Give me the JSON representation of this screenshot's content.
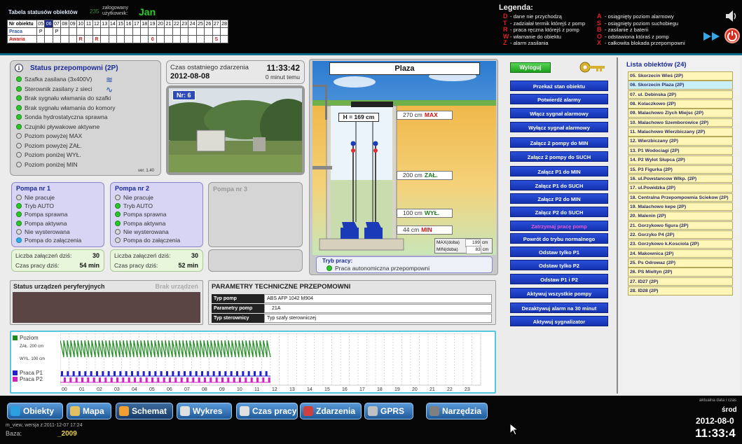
{
  "header": {
    "table_title": "Tabela statusów obiektów",
    "logged_count": "235",
    "user_label": "zalogowany użytkownik:",
    "user_name": "Jan",
    "grid_rows": [
      {
        "label": "Nr obiektu",
        "cells": [
          "05",
          "06",
          "07",
          "08",
          "09",
          "10",
          "11",
          "12",
          "13",
          "14",
          "15",
          "16",
          "17",
          "18",
          "19",
          "20",
          "21",
          "22",
          "23",
          "24",
          "25",
          "26",
          "27",
          "28"
        ]
      },
      {
        "label": "Praca",
        "cells": [
          "P",
          "",
          "P",
          "",
          "",
          "",
          "",
          "",
          "",
          "",
          "",
          "",
          "",
          "",
          "",
          "",
          "",
          "",
          "",
          "",
          "",
          "",
          "",
          ""
        ]
      },
      {
        "label": "Awaria",
        "cells": [
          "",
          "",
          "",
          "",
          "",
          "R",
          "",
          "R",
          "",
          "",
          "",
          "",
          "",
          "",
          "0",
          "",
          "",
          "",
          "",
          "",
          "",
          "",
          "S",
          ""
        ]
      }
    ]
  },
  "legend": {
    "title": "Legenda:",
    "left": [
      {
        "key": "D",
        "text": "- dane nie przychodzą"
      },
      {
        "key": "T",
        "text": "- zadziałał termik którejś z pomp"
      },
      {
        "key": "R",
        "text": "- praca ręczna którejś z pomp"
      },
      {
        "key": "W",
        "text": "- włamanie do obiektu"
      },
      {
        "key": "Z",
        "text": "- alarm zasilania"
      }
    ],
    "right": [
      {
        "key": "A",
        "text": "- osiągnięty poziom alarmowy"
      },
      {
        "key": "S",
        "text": "- osiągnięty poziom suchobiegu"
      },
      {
        "key": "B",
        "text": "- zasilanie z baterii"
      },
      {
        "key": "O",
        "text": "- odstawiona któraś z pomp"
      },
      {
        "key": "X",
        "text": "- całkowita blokada przepompowni"
      }
    ]
  },
  "status": {
    "title": "Status przepompowni (2P)",
    "version": "ver. 1.40",
    "items": [
      {
        "text": "Szafka zasilana (3x400V)",
        "state": "green"
      },
      {
        "text": "Sterownik zasilany z sieci",
        "state": "green"
      },
      {
        "text": "Brak sygnału włamania do szafki",
        "state": "green"
      },
      {
        "text": "Brak sygnału włamania do komory",
        "state": "green"
      },
      {
        "text": "Sonda hydrostatyczna sprawna",
        "state": "green"
      },
      {
        "text": "Czujniki pływakowe aktywne",
        "state": "green"
      },
      {
        "text": "Poziom powyżej MAX",
        "state": "off"
      },
      {
        "text": "Poziom powyżej ZAŁ.",
        "state": "off"
      },
      {
        "text": "Poziom poniżej WYŁ.",
        "state": "off"
      },
      {
        "text": "Poziom poniżej MIN",
        "state": "off"
      }
    ]
  },
  "last_event": {
    "label": "Czas ostatniego zdarzenia",
    "time": "11:33:42",
    "date": "2012-08-08",
    "ago": "0 minut temu"
  },
  "camera": {
    "label": "Nr: 6"
  },
  "pumps": [
    {
      "title": "Pompa nr 1",
      "items": [
        {
          "text": "Nie pracuje",
          "state": "off"
        },
        {
          "text": "Tryb AUTO",
          "state": "green"
        },
        {
          "text": "Pompa sprawna",
          "state": "green"
        },
        {
          "text": "Pompa aktywna",
          "state": "green"
        },
        {
          "text": "Nie wysterowana",
          "state": "off"
        },
        {
          "text": "Pompa do załączenia",
          "state": "blue"
        }
      ],
      "starts_label": "Liczba załączeń dziś:",
      "starts": "30",
      "time_label": "Czas pracy dziś:",
      "time": "54 min"
    },
    {
      "title": "Pompa nr 2",
      "items": [
        {
          "text": "Nie pracuje",
          "state": "off"
        },
        {
          "text": "Tryb AUTO",
          "state": "green"
        },
        {
          "text": "Pompa sprawna",
          "state": "green"
        },
        {
          "text": "Pompa aktywna",
          "state": "green"
        },
        {
          "text": "Nie wysterowana",
          "state": "off"
        },
        {
          "text": "Pompa do załączenia",
          "state": "off"
        }
      ],
      "starts_label": "Liczba załączeń dziś:",
      "starts": "30",
      "time_label": "Czas pracy dziś:",
      "time": "52 min"
    }
  ],
  "pump3": {
    "title": "Pompa nr 3"
  },
  "station": {
    "name": "Plaza",
    "height": "H = 169 cm",
    "levels": [
      {
        "label": "270 cm",
        "tag": "MAX",
        "color": "#d01010"
      },
      {
        "label": "200 cm",
        "tag": "ZAŁ.",
        "color": "#1a7a1a"
      },
      {
        "label": "100 cm",
        "tag": "WYŁ.",
        "color": "#1a7a1a"
      },
      {
        "label": "44 cm",
        "tag": "MIN",
        "color": "#d01010"
      }
    ],
    "max_label": "MAX(doba)",
    "max_value": "199",
    "max_unit": "cm",
    "min_label": "MIN(doba)",
    "min_value": "83",
    "min_unit": "cm",
    "mode_label": "Tryb pracy:",
    "mode": "Praca autonomiczna przepompowni"
  },
  "peripherals": {
    "title": "Status urządzeń peryferyjnych",
    "status": "Brak urządzeń"
  },
  "params": {
    "title": "PARAMETRY TECHNICZNE PRZEPOMOWNI",
    "rows": [
      {
        "label": "Typ pomp",
        "value": "ABS AFP 1042 M904"
      },
      {
        "label": "Parametry pomp",
        "value": "21A"
      },
      {
        "label": "Typ sterownicy",
        "value": "Typ szafy sterowniczej"
      }
    ]
  },
  "chart": {
    "legend": [
      {
        "name": "Poziom",
        "color": "#1a8a1a"
      },
      {
        "name": "ZAŁ. 200 cm",
        "color": ""
      },
      {
        "name": "WYŁ. 100 cm",
        "color": ""
      },
      {
        "name": "Praca P1",
        "color": "#2222cc"
      },
      {
        "name": "Praca P2",
        "color": "#d020c0"
      }
    ],
    "hours": [
      "00",
      "01",
      "02",
      "03",
      "04",
      "05",
      "06",
      "07",
      "08",
      "09",
      "10",
      "11",
      "12",
      "13",
      "14",
      "15",
      "16",
      "17",
      "18",
      "19",
      "20",
      "21",
      "22",
      "23"
    ]
  },
  "chart_data": {
    "type": "line",
    "x": [
      "00",
      "01",
      "02",
      "03",
      "04",
      "05",
      "06",
      "07",
      "08",
      "09",
      "10",
      "11",
      "12",
      "13",
      "14",
      "15",
      "16",
      "17",
      "18",
      "19",
      "20",
      "21",
      "22",
      "23"
    ],
    "series": [
      {
        "name": "Poziom",
        "values": [
          150,
          150,
          150,
          150,
          150,
          150,
          150,
          150,
          150,
          150,
          150,
          150,
          null,
          null,
          null,
          null,
          null,
          null,
          null,
          null,
          null,
          null,
          null,
          null
        ]
      },
      {
        "name": "Praca P1",
        "values": [
          1,
          1,
          1,
          1,
          1,
          1,
          1,
          1,
          1,
          1,
          1,
          1,
          null,
          null,
          null,
          null,
          null,
          null,
          null,
          null,
          null,
          null,
          null,
          null
        ]
      },
      {
        "name": "Praca P2",
        "values": [
          1,
          1,
          1,
          1,
          1,
          1,
          1,
          1,
          1,
          1,
          1,
          1,
          null,
          null,
          null,
          null,
          null,
          null,
          null,
          null,
          null,
          null,
          null,
          null
        ]
      }
    ],
    "levels": {
      "zal": 200,
      "wyl": 100
    }
  },
  "actions": {
    "logout": "Wyloguj",
    "buttons": [
      {
        "label": "Przekaż stan obiektu",
        "style": "blue"
      },
      {
        "label": "Potwierdź alarmy",
        "style": "blue"
      },
      {
        "label": "Włącz sygnał alarmowy",
        "style": "blue"
      },
      {
        "label": "Wyłącz sygnał alarmowy",
        "style": "blue"
      },
      {
        "label": "Załącz 2 pompy do MIN",
        "style": "blue"
      },
      {
        "label": "Załącz 2 pompy do SUCH",
        "style": "blue"
      },
      {
        "label": "Załącz P1 do MIN",
        "style": "blue"
      },
      {
        "label": "Załącz P1 do SUCH",
        "style": "blue"
      },
      {
        "label": "Załącz P2 do MIN",
        "style": "blue"
      },
      {
        "label": "Załącz P2 do SUCH",
        "style": "blue"
      },
      {
        "label": "Zatrzymaj pracę pomp",
        "style": "pink"
      },
      {
        "label": "Powrót do trybu normalnego",
        "style": "blue"
      },
      {
        "label": "Odstaw tylko P1",
        "style": "blue"
      },
      {
        "label": "Odstaw tylko P2",
        "style": "blue"
      },
      {
        "label": "Odstaw P1 i P2",
        "style": "blue"
      },
      {
        "label": "Aktywuj wszystkie pompy",
        "style": "blue"
      },
      {
        "label": "Dezaktywuj alarm na 30 minut",
        "style": "blue"
      },
      {
        "label": "Aktywuj sygnalizator",
        "style": "blue"
      }
    ]
  },
  "objects": {
    "title": "Lista obiektów (24)",
    "items": [
      "05. Skorzecin Wieś (2P)",
      "06. Skorzecin Plaza (2P)",
      "07. ul. Debinska (2P)",
      "08. Kolaczkowo (2P)",
      "09. Malachowo Zlych Miejsc (2P)",
      "10. Malachowo Szemborowice (2P)",
      "11. Malachowo Wierzbiczany (2P)",
      "12. Wierzbiczany (2P)",
      "13. P1 Wodociagi (2P)",
      "14. P2 Wylot Słupca (2P)",
      "15. P3 Figurka (2P)",
      "16. ul.Powstancow Wlkp. (2P)",
      "17. ul.Powidzka (2P)",
      "18. Centralna Przepompownia Sciekow (2P)",
      "19. Malachowo kepe (2P)",
      "20. Malenin (2P)",
      "21. Gorzykowo figura (2P)",
      "22. Gorzyko P4 (2P)",
      "23. Gorzykowo k.Kosciola (2P)",
      "24. Makownica (2P)",
      "25. Ps Odrowaz (2P)",
      "26. PS Mieltyn (2P)",
      "27. ID27 (2P)",
      "28. ID28 (2P)"
    ],
    "selected_index": 1
  },
  "nav": {
    "buttons": [
      {
        "label": "Obiekty",
        "color": "#2aa0e0"
      },
      {
        "label": "Mapa",
        "color": "#e0c060"
      },
      {
        "label": "Schemat",
        "color": "#f0a030"
      },
      {
        "label": "Wykres",
        "color": "#e0e0e0"
      },
      {
        "label": "Czas pracy",
        "color": "#e0e0e0"
      },
      {
        "label": "Zdarzenia",
        "color": "#d04040"
      },
      {
        "label": "GPRS",
        "color": "#c0c0c0"
      },
      {
        "label": "Narzędzia",
        "color": "#808080"
      }
    ]
  },
  "footer": {
    "version": "m_view, wersja z:2011-12-07 17:24",
    "db_label": "Baza:",
    "db_value": "_2009",
    "sync": "aktualna data i czas",
    "day": "środ",
    "date": "2012-08-0",
    "time": "11:33:4"
  }
}
